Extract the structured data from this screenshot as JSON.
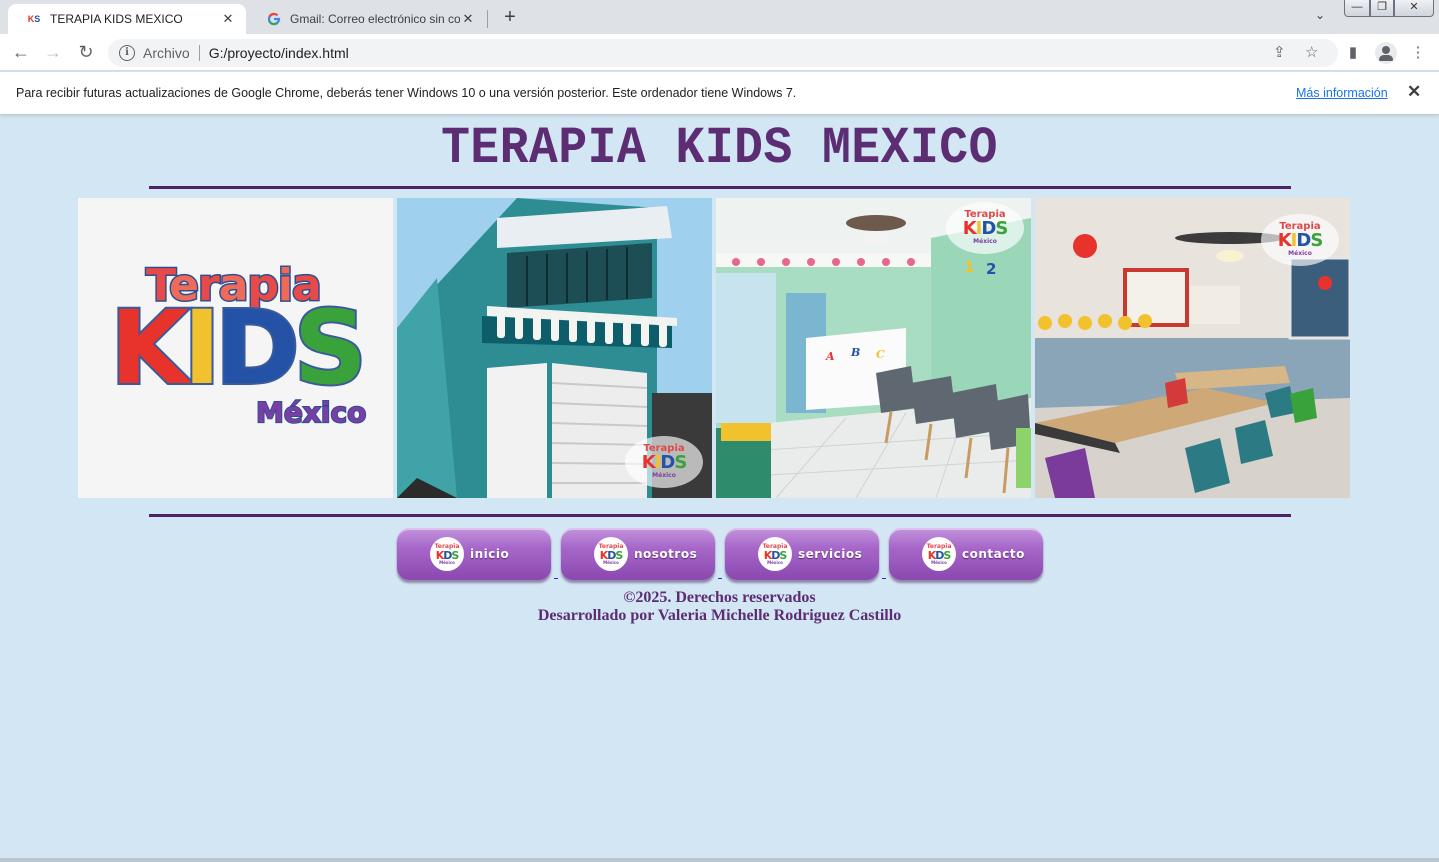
{
  "browser": {
    "tabs": [
      {
        "title": "TERAPIA KIDS MEXICO",
        "active": true
      },
      {
        "title": "Gmail: Correo electrónico sin costo",
        "active": false
      }
    ],
    "address": {
      "scheme_label": "Archivo",
      "url": "G:/proyecto/index.html"
    },
    "infobar": {
      "message": "Para recibir futuras actualizaciones de Google Chrome, deberás tener Windows 10 o una versión posterior. Este ordenador tiene Windows 7.",
      "link": "Más información"
    },
    "window_controls": {
      "minimize": "—",
      "maximize": "❐",
      "close": "✕"
    }
  },
  "page": {
    "title": "TERAPIA KIDS MEXICO",
    "colors": {
      "primary": "#5c2d72",
      "background": "#d3e6f3",
      "button": "#a767c9"
    },
    "logo": {
      "line1": "Terapia",
      "line2": "KIDS",
      "line3": "México"
    },
    "gallery": [
      {
        "name": "logo"
      },
      {
        "name": "exterior-building"
      },
      {
        "name": "reception"
      },
      {
        "name": "classroom"
      }
    ],
    "nav": [
      {
        "label": "inicio"
      },
      {
        "label": "nosotros"
      },
      {
        "label": "servicios"
      },
      {
        "label": "contacto"
      }
    ],
    "footer": {
      "copyright": "©2025. Derechos reservados",
      "developer": "Desarrollado por Valeria Michelle Rodriguez Castillo"
    }
  }
}
